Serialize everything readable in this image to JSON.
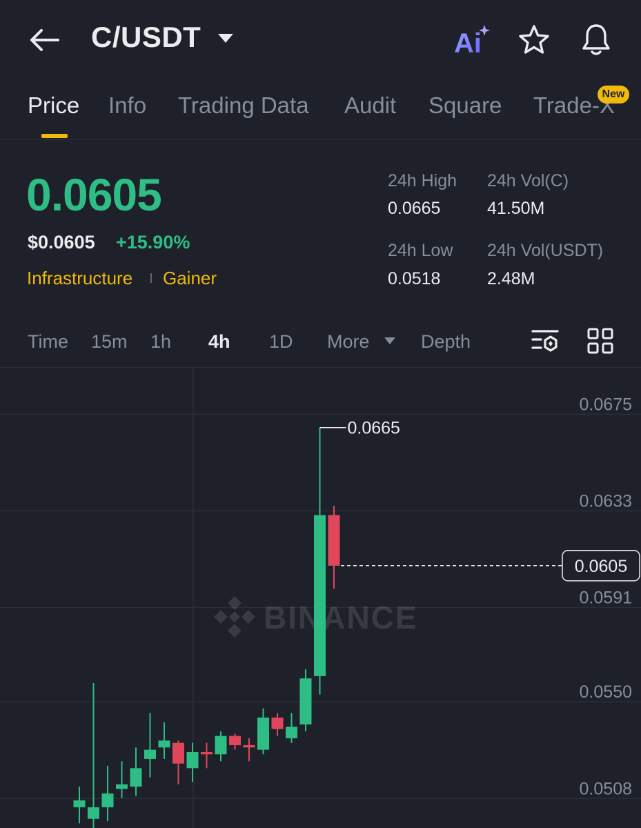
{
  "header": {
    "title": "C/USDT",
    "icons": {
      "back": "arrow-left-icon",
      "dropdown": "caret-down-icon",
      "ai": "ai-sparkle-icon",
      "favorite": "star-icon",
      "alerts": "bell-icon"
    },
    "ai_label": "Ai"
  },
  "tabs": [
    {
      "label": "Price",
      "active": true
    },
    {
      "label": "Info",
      "active": false
    },
    {
      "label": "Trading Data",
      "active": false
    },
    {
      "label": "Audit",
      "active": false
    },
    {
      "label": "Square",
      "active": false
    },
    {
      "label": "Trade-X",
      "active": false
    }
  ],
  "new_badge": "New",
  "ticker": {
    "last_price": "0.0605",
    "usd_price": "$0.0605",
    "change_pct": "+15.90%",
    "tags": [
      "Infrastructure",
      "Gainer"
    ]
  },
  "stats": {
    "high_label": "24h High",
    "high_value": "0.0665",
    "vol_base_label": "24h Vol(C)",
    "vol_base_value": "41.50M",
    "low_label": "24h Low",
    "low_value": "0.0518",
    "vol_quote_label": "24h Vol(USDT)",
    "vol_quote_value": "2.48M"
  },
  "intervals": [
    {
      "label": "Time",
      "active": false
    },
    {
      "label": "15m",
      "active": false
    },
    {
      "label": "1h",
      "active": false
    },
    {
      "label": "4h",
      "active": true
    },
    {
      "label": "1D",
      "active": false
    },
    {
      "label": "More",
      "active": false
    },
    {
      "label": "Depth",
      "active": false
    }
  ],
  "colors": {
    "up": "#2ebd85",
    "down": "#e0475c",
    "accent": "#f0b90b",
    "bg": "#1e2129"
  },
  "chart_data": {
    "type": "candlestick",
    "watermark": "BINANCE",
    "y_ticks": [
      "0.0675",
      "0.0633",
      "0.0591",
      "0.0550",
      "0.0508"
    ],
    "ylim": [
      0.0491,
      0.0691
    ],
    "high_marker": "0.0665",
    "last_price_marker": "0.0605",
    "candles": [
      {
        "o": 0.05,
        "h": 0.0509,
        "l": 0.0493,
        "c": 0.0503
      },
      {
        "o": 0.0495,
        "h": 0.0554,
        "l": 0.049,
        "c": 0.05
      },
      {
        "o": 0.05,
        "h": 0.0518,
        "l": 0.0494,
        "c": 0.0506
      },
      {
        "o": 0.0508,
        "h": 0.052,
        "l": 0.0504,
        "c": 0.051
      },
      {
        "o": 0.0509,
        "h": 0.0526,
        "l": 0.0505,
        "c": 0.0517
      },
      {
        "o": 0.0521,
        "h": 0.0541,
        "l": 0.0513,
        "c": 0.0525
      },
      {
        "o": 0.0526,
        "h": 0.0537,
        "l": 0.0521,
        "c": 0.0529
      },
      {
        "o": 0.0528,
        "h": 0.0529,
        "l": 0.051,
        "c": 0.0519
      },
      {
        "o": 0.0517,
        "h": 0.0528,
        "l": 0.0511,
        "c": 0.0524
      },
      {
        "o": 0.0524,
        "h": 0.0528,
        "l": 0.0517,
        "c": 0.0523
      },
      {
        "o": 0.0523,
        "h": 0.0533,
        "l": 0.052,
        "c": 0.0531
      },
      {
        "o": 0.0531,
        "h": 0.0532,
        "l": 0.0525,
        "c": 0.0527
      },
      {
        "o": 0.0527,
        "h": 0.053,
        "l": 0.052,
        "c": 0.0526
      },
      {
        "o": 0.0525,
        "h": 0.0543,
        "l": 0.0523,
        "c": 0.0539
      },
      {
        "o": 0.0539,
        "h": 0.0541,
        "l": 0.0531,
        "c": 0.0534
      },
      {
        "o": 0.053,
        "h": 0.0541,
        "l": 0.0528,
        "c": 0.0535
      },
      {
        "o": 0.0536,
        "h": 0.056,
        "l": 0.0533,
        "c": 0.0556
      },
      {
        "o": 0.0557,
        "h": 0.0665,
        "l": 0.0549,
        "c": 0.0627
      },
      {
        "o": 0.0627,
        "h": 0.0631,
        "l": 0.0595,
        "c": 0.0605
      }
    ]
  }
}
